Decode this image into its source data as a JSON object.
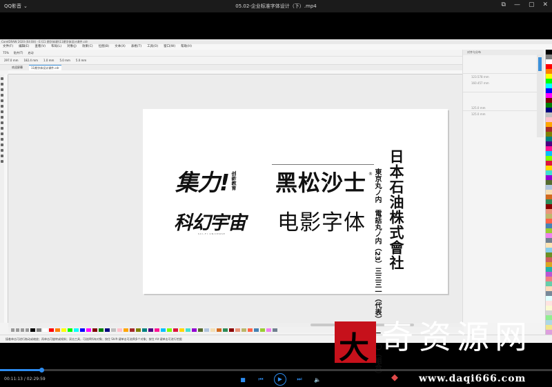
{
  "player": {
    "app_name": "QQ影音",
    "dropdown_icon": "chevron-down-icon",
    "file_title": "05.02-企业标准字体设计（下）.mp4",
    "window_controls": [
      "pin-icon",
      "minimize-icon",
      "maximize-icon",
      "close-icon"
    ],
    "time_display": "00:11:13 / 02:29:59",
    "progress_fraction": 0.075,
    "accent_color": "#2d8cf0"
  },
  "coreldraw": {
    "title_bar": "CorelDRAW 2020 (64 Bit) - E:\\11 期字体课\\\\11期字体设计课件.cdr",
    "menu": [
      "文件(F)",
      "编辑(E)",
      "查看(V)",
      "布局(L)",
      "对象(J)",
      "效果(C)",
      "位图(B)",
      "文本(X)",
      "表格(T)",
      "工具(O)",
      "窗口(W)",
      "帮助(H)"
    ],
    "toolbar": [
      "75%",
      "贴齐(T)",
      "启动"
    ],
    "property_bar": [
      "297.0 mm",
      "182.4 mm",
      "1.0 mm",
      "5.0 mm",
      "5.0 mm"
    ],
    "tabs": [
      "欢迎屏幕",
      "11期字体设计课件.cdr"
    ],
    "docker_title": "对齐与分布",
    "docker_rows": [
      "",
      "",
      "",
      "123.578 mm",
      "160.457 mm",
      "",
      "",
      "",
      "125.0 mm",
      "125.0 mm"
    ],
    "status_bar": "接着单击可进行拖动或缩放；再单击可旋转或倾斜；双击工具，可选择所有对象；按住 Shift 键单击可选择多个对象；按住 Alt 键单击可进行挖掘",
    "palette_colors": [
      "#000000",
      "#7f7f7f",
      "#ffffff",
      "#ff0000",
      "#ff7f00",
      "#ffff00",
      "#00ff00",
      "#00ffff",
      "#0000ff",
      "#ff00ff",
      "#7f0000",
      "#007f00",
      "#00007f",
      "#c0c0c0",
      "#ffc0cb",
      "#ffa500",
      "#a52a2a",
      "#808000",
      "#008080",
      "#4b0082",
      "#ff1493",
      "#00bfff",
      "#7fff00",
      "#dc143c",
      "#ffd700",
      "#40e0d0",
      "#9400d3",
      "#556b2f",
      "#b0c4de",
      "#f5deb3",
      "#d2691e",
      "#2e8b57",
      "#8b0000",
      "#e9967a",
      "#bdb76b",
      "#ff6347",
      "#4682b4",
      "#9acd32",
      "#ee82ee",
      "#708090",
      "#ffe4b5",
      "#87ceeb",
      "#6b8e23",
      "#cd5c5c",
      "#daa520",
      "#20b2aa",
      "#ba55d3",
      "#f08080",
      "#66cdaa",
      "#ffdab9",
      "#778899",
      "#e0ffff",
      "#ffe4e1",
      "#fafad2",
      "#d3d3d3",
      "#90ee90",
      "#add8e6",
      "#f0e68c",
      "#dda0dd",
      "#b22222"
    ]
  },
  "logos": {
    "jili": "集力!",
    "jili_tag": "创新教育",
    "heisong": "黑松沙士",
    "registered_mark": "®",
    "kehuan": "科幻宇宙",
    "kehuan_sub": "SCI-FI UNIVERSE",
    "dianying": "电影字体",
    "nippon_main": "日本石油株式會社",
    "nippon_sub": "東京丸ノ内　電話丸ノ内（23）三三三一（代表）三三三〇（組合）"
  },
  "watermark": {
    "logo_char": "大",
    "logo_color": "#c6111b",
    "text": "奇资源网",
    "site": "www.daqi666.com"
  }
}
